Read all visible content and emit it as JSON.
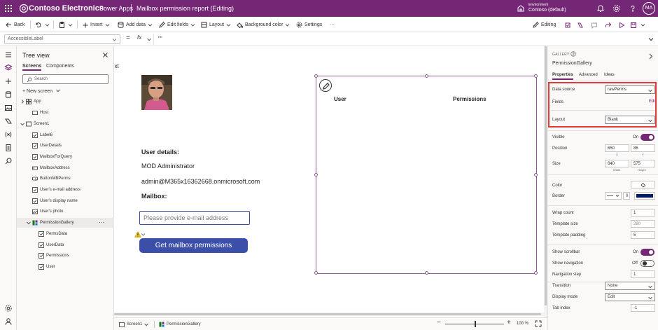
{
  "header": {
    "brand": "Contoso Electronics",
    "product": "Power Apps",
    "app_title": "Mailbox permission report (Editing)",
    "environment_label": "Environment",
    "environment_name": "Contoso (default)",
    "user_initials": "MA"
  },
  "commandbar": {
    "back": "Back",
    "insert": "Insert",
    "add_data": "Add data",
    "edit_fields": "Edit fields",
    "layout": "Layout",
    "background_color": "Background color",
    "settings": "Settings",
    "editing": "Editing"
  },
  "formula_bar": {
    "property": "AccessibleLabel",
    "equals": "=",
    "fx": "fx",
    "formula": "\"\""
  },
  "tree": {
    "title": "Tree view",
    "tabs": [
      "Screens",
      "Components"
    ],
    "search_placeholder": "Search",
    "new_screen": "New screen",
    "items": [
      "App",
      "Host",
      "Screen1",
      "Label6",
      "UserDetails",
      "MailboxForQuery",
      "MailboxAddress",
      "ButtonMBPerms",
      "User's e-mail address",
      "User's display name",
      "User's photo",
      "PermissionGallery",
      "PermsData",
      "UserData",
      "Permissions",
      "User"
    ],
    "more": "···"
  },
  "canvas": {
    "label_fragment": "ext",
    "user_details": "User details:",
    "display_name": "MOD Administrator",
    "email": "admin@M365x16362668.onmicrosoft.com",
    "mailbox_label": "Mailbox:",
    "mailbox_placeholder": "Please provide e-mail address",
    "get_button": "Get mailbox permissions",
    "gallery_col_user": "User",
    "gallery_col_permissions": "Permissions"
  },
  "status": {
    "screen": "Screen1",
    "control": "PermissionGallery",
    "zoom_minus": "−",
    "zoom_plus": "+",
    "zoom_value": "100 %",
    "zoom_level": 100
  },
  "pane": {
    "kind": "GALLERY",
    "control_name": "PermissionGallery",
    "tabs": [
      "Properties",
      "Advanced",
      "Ideas"
    ],
    "data_source_label": "Data source",
    "data_source_value": "rawPerms",
    "fields_label": "Fields",
    "fields_edit": "Edit",
    "layout_label": "Layout",
    "layout_value": "Blank",
    "visible_label": "Visible",
    "visible_state": "On",
    "position_label": "Position",
    "position_x": "650",
    "position_y": "86",
    "x_label": "X",
    "y_label": "Y",
    "size_label": "Size",
    "size_w": "640",
    "size_h": "575",
    "width_label": "Width",
    "height_label": "Height",
    "color_label": "Color",
    "border_label": "Border",
    "border_width": "0",
    "wrap_count_label": "Wrap count",
    "wrap_count": "1",
    "template_size_label": "Template size",
    "template_size": "280",
    "template_padding_label": "Template padding",
    "template_padding": "5",
    "show_scrollbar_label": "Show scrollbar",
    "show_scrollbar_state": "On",
    "show_navigation_label": "Show navigation",
    "show_navigation_state": "Off",
    "navigation_step_label": "Navigation step",
    "navigation_step": "1",
    "transition_label": "Transition",
    "transition_value": "None",
    "display_mode_label": "Display mode",
    "display_mode_value": "Edit",
    "tab_index_label": "Tab index",
    "tab_index": "-1"
  },
  "colors": {
    "header": "#742774",
    "button": "#3b4fa8",
    "highlight": "#e03a3a",
    "border_swatch": "#001a66"
  }
}
